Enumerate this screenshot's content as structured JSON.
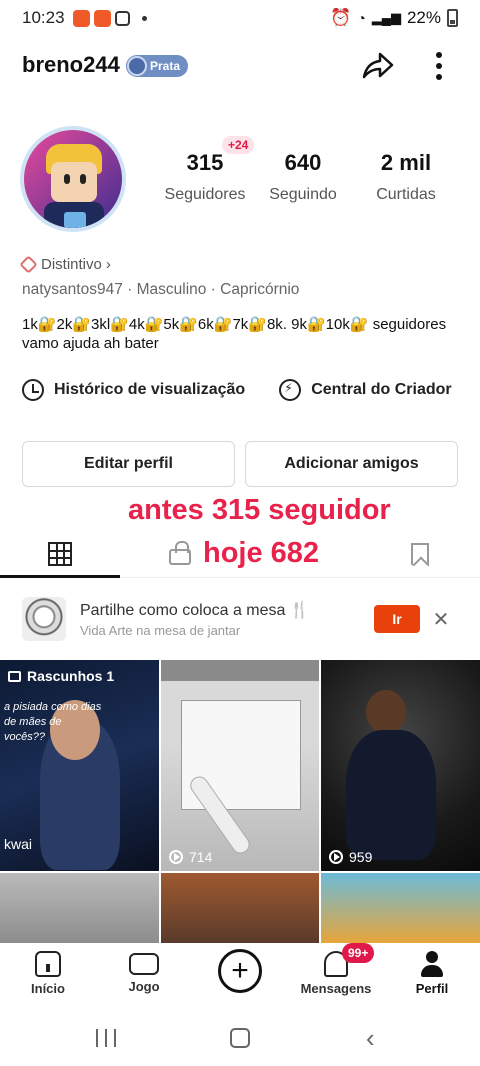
{
  "status_bar": {
    "time": "10:23",
    "battery": "22%"
  },
  "profile": {
    "username": "breno244",
    "level_badge": "Prata",
    "new_followers_badge": "+24",
    "stats": [
      {
        "value": "315",
        "label": "Seguidores"
      },
      {
        "value": "640",
        "label": "Seguindo"
      },
      {
        "value": "2 mil",
        "label": "Curtidas"
      }
    ],
    "distintivo": "Distintivo",
    "meta": "natysantos947 · Masculino · Capricórnio",
    "bio": "1k🔐2k🔐3kl🔐4k🔐5k🔐6k🔐7k🔐8k.  9k🔐10k🔐 seguidores  vamo ajuda ah bater"
  },
  "quick_actions": [
    {
      "label": "Histórico de visualização",
      "icon": "clock-icon"
    },
    {
      "label": "Central do Criador",
      "icon": "bolt-icon"
    }
  ],
  "buttons": {
    "edit": "Editar perfil",
    "add_friends": "Adicionar amigos"
  },
  "overlay": {
    "line1": "antes 315 seguidor",
    "line2": "hoje 682"
  },
  "promo": {
    "title": "Partilhe como coloca a mesa 🍴",
    "subtitle": "Vida Arte na mesa de jantar",
    "button": "Ir"
  },
  "grid": {
    "drafts_label": "Rascunhos 1",
    "draft_caption": "a pisiada como dias de mães de vocês??",
    "draft_watermark": "kwai",
    "items": [
      {
        "plays": "714"
      },
      {
        "plays": "959"
      }
    ]
  },
  "bottom_nav": [
    {
      "label": "Início",
      "icon": "home-icon"
    },
    {
      "label": "Jogo",
      "icon": "gamepad-icon"
    },
    {
      "label": "",
      "icon": "plus-icon"
    },
    {
      "label": "Mensagens",
      "icon": "bell-icon",
      "badge": "99+"
    },
    {
      "label": "Perfil",
      "icon": "person-icon"
    }
  ],
  "colors": {
    "accent": "#e8410c",
    "overlay_text": "#e8224a",
    "badge": "#e0194a"
  }
}
